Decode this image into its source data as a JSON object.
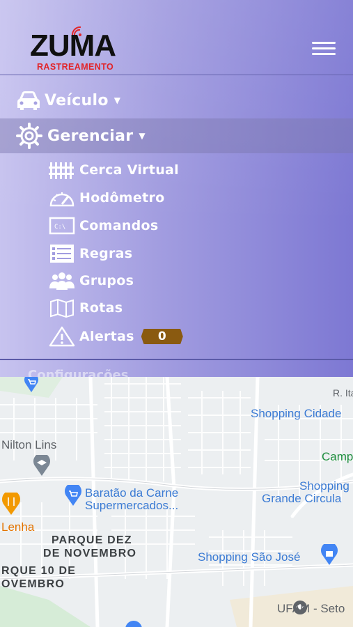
{
  "app": {
    "logo_main_pre": "ZU",
    "logo_main_red": "",
    "logo_main_post": "MA",
    "logo_sub": "RASTREAMENTO"
  },
  "nav": {
    "vehicle_label": "Veículo",
    "manage_label": "Gerenciar",
    "peek_label": "Configurações"
  },
  "submenu": [
    {
      "label": "Cerca Virtual",
      "icon": "fence-icon"
    },
    {
      "label": "Hodômetro",
      "icon": "speedometer-icon"
    },
    {
      "label": "Comandos",
      "icon": "terminal-icon"
    },
    {
      "label": "Regras",
      "icon": "checklist-icon"
    },
    {
      "label": "Grupos",
      "icon": "group-icon"
    },
    {
      "label": "Rotas",
      "icon": "map-icon"
    },
    {
      "label": "Alertas",
      "icon": "warning-icon"
    }
  ],
  "alerts_count": "0",
  "colors": {
    "badge": "#8a5a10",
    "logo_red": "#e0161b",
    "map_blue_label": "#3b7bd4"
  },
  "map": {
    "labels": {
      "shopping_cidade": "Shopping Cidade",
      "camp": "Camp",
      "nilton_lins": "Nilton Lins",
      "shopping_grande_1": "Shopping",
      "shopping_grande_2": "Grande Circula",
      "baratao_1": "Baratão da Carne",
      "baratao_2": "Supermercados...",
      "lenha": "Lenha",
      "parque_dez_1": "PARQUE DEZ",
      "parque_dez_2": "DE NOVEMBRO",
      "parque_10_1": "RQUE 10 DE",
      "parque_10_2": "OVEMBRO",
      "shopping_sao_jose": "Shopping São José",
      "ufam": "UFAM - Seto",
      "r_ita": "R. Ita"
    }
  }
}
